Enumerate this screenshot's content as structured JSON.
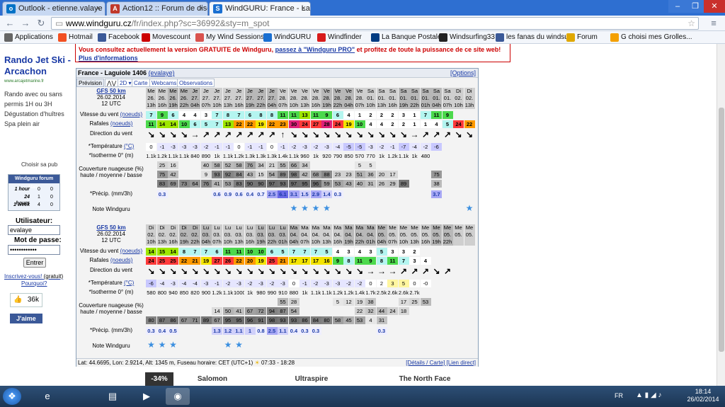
{
  "browser": {
    "tabs": [
      {
        "label": "Outlook - etienne.valaye",
        "icon": "outlook-icon",
        "icon_text": "o"
      },
      {
        "label": "Action12 :: Forum de disc",
        "icon": "forum-icon",
        "icon_text": "A"
      },
      {
        "label": "WindGURU: France - Lagu",
        "icon": "windguru-icon",
        "icon_text": "S"
      }
    ],
    "tab_close": "×",
    "url_domain": "www.windguru.cz",
    "url_path": "/fr/index.php?sc=36992&sty=m_spot",
    "bookmarks": [
      {
        "label": "Applications",
        "icon": "apps-icon",
        "color": "#666"
      },
      {
        "label": "Hotmail",
        "icon": "hotmail-icon",
        "color": "#f25022"
      },
      {
        "label": "Facebook",
        "icon": "facebook-icon",
        "color": "#3b5998"
      },
      {
        "label": "Movescount",
        "icon": "movescount-icon",
        "color": "#c00"
      },
      {
        "label": "My Wind Sessions",
        "icon": "windsessions-icon",
        "color": "#d9534f"
      },
      {
        "label": "WindGURU",
        "icon": "windguru-bm-icon",
        "color": "#1a6fd1"
      },
      {
        "label": "Windfinder",
        "icon": "windfinder-icon",
        "color": "#d81b1b"
      },
      {
        "label": "La Banque Postale",
        "icon": "banque-icon",
        "color": "#003c82"
      },
      {
        "label": "Windsurfing33",
        "icon": "windsurfing-icon",
        "color": "#222"
      },
      {
        "label": "les fanas du windsurf",
        "icon": "fanas-icon",
        "color": "#3b5998"
      },
      {
        "label": "Forum",
        "icon": "folder-icon",
        "color": "#e0a800"
      },
      {
        "label": "G choisi mes Grolles...",
        "icon": "grolles-icon",
        "color": "#f4a000"
      }
    ]
  },
  "sidebar": {
    "ad_title": "Rando Jet Ski - Arcachon",
    "ad_url": "www.arcajetmarine.fr",
    "ad_text": "Rando avec ou sans permis 1H ou 3H Dégustation d'huîtres Spa plein air",
    "ad_choice": "Choisir sa pub",
    "forum_stats_title": "Windguru forum stats",
    "stats": [
      {
        "k": "1 hour",
        "a": "0",
        "b": "0"
      },
      {
        "k": "24 hours",
        "a": "1",
        "b": "0"
      },
      {
        "k": "1 week",
        "a": "4",
        "b": "0"
      }
    ],
    "user_label": "Utilisateur:",
    "user_value": "evalaye",
    "pass_label": "Mot de passe:",
    "pass_value": "••••••••••••",
    "enter": "Entrer",
    "register": "Inscrivez-vous!",
    "register_note": "(gratuit)",
    "why": "Pourquoi?",
    "likes": "36k",
    "like_btn": "J'aime"
  },
  "notice": {
    "text1": "Vous consultez actuellement la version GRATUITE de Windguru,",
    "link1": "passez à \"Windguru PRO\"",
    "text2": "et profitez de toute la puissance de ce site web!",
    "link2": "Plus d'informations"
  },
  "panel": {
    "title": "France - Laguiole 1406",
    "user": "(evalaye)",
    "options": "[Options]",
    "tabs": [
      "Prévision",
      "2D ▾",
      "Carte",
      "Webcams",
      "Observations"
    ],
    "footer": "Lat: 44.6695, Lon: 2.9214, Alt: 1345 m, Fuseau horaire: CET (UTC+1)",
    "sun": "07:33 - 18:28",
    "footer_links": "[Détails / Carte] [Lien direct]"
  },
  "labels": {
    "model": "GFS 50 km",
    "date": "26.02.2014",
    "utc": "12 UTC",
    "wind": "Vitesse du vent",
    "wind_unit": "(noeuds)",
    "gust": "Rafales",
    "dir": "Direction du vent",
    "temp": "*Température",
    "temp_unit": "(°C)",
    "iso": "*Isotherme 0° (m)",
    "cloud": "Couverture nuageuse (%) haute / moyenne / basse",
    "precip": "*Précip. (mm/3h)",
    "rating": "Note Windguru"
  },
  "block1": {
    "day": [
      "Me",
      "Me",
      "Me",
      "Me",
      "Je",
      "Je",
      "Je",
      "Je",
      "Je",
      "Je",
      "Je",
      "Je",
      "Ve",
      "Ve",
      "Ve",
      "Ve",
      "Ve",
      "Ve",
      "Ve",
      "Ve",
      "Sa",
      "Sa",
      "Sa",
      "Sa",
      "Sa",
      "Sa",
      "Sa",
      "Sa",
      "Di",
      "Di"
    ],
    "dnum": [
      "26.",
      "26.",
      "26.",
      "26.",
      "27.",
      "27.",
      "27.",
      "27.",
      "27.",
      "27.",
      "27.",
      "27.",
      "28.",
      "28.",
      "28.",
      "28.",
      "28.",
      "28.",
      "28.",
      "28.",
      "01.",
      "01.",
      "01.",
      "01.",
      "01.",
      "01.",
      "01.",
      "01.",
      "02.",
      "02."
    ],
    "hour": [
      "13h",
      "16h",
      "19h",
      "22h",
      "04h",
      "07h",
      "10h",
      "13h",
      "16h",
      "19h",
      "22h",
      "04h",
      "07h",
      "10h",
      "13h",
      "16h",
      "19h",
      "22h",
      "04h",
      "07h",
      "10h",
      "13h",
      "16h",
      "19h",
      "22h",
      "01h",
      "04h",
      "07h",
      "10h",
      "13h"
    ],
    "wind": [
      "7",
      "9",
      "6",
      "4",
      "4",
      "3",
      "7",
      "8",
      "7",
      "6",
      "8",
      "8",
      "11",
      "11",
      "13",
      "11",
      "9",
      "6",
      "4",
      "1",
      "2",
      "2",
      "2",
      "3",
      "1",
      "7",
      "11",
      "9",
      "",
      ""
    ],
    "gust": [
      "11",
      "14",
      "14",
      "10",
      "6",
      "5",
      "7",
      "13",
      "22",
      "22",
      "19",
      "22",
      "23",
      "30",
      "24",
      "27",
      "28",
      "24",
      "19",
      "10",
      "4",
      "4",
      "2",
      "2",
      "1",
      "1",
      "4",
      "5",
      "24",
      "22"
    ],
    "dir": [
      "↘",
      "↘",
      "↘",
      "↘",
      "→",
      "↗",
      "↗",
      "↗",
      "↗",
      "↗",
      "↗",
      "↗",
      "↑",
      "↘",
      "↘",
      "↘",
      "↘",
      "↘",
      "↘",
      "↘",
      "↘",
      "↘",
      "↘",
      "↘",
      "→",
      "↗",
      "↗",
      "↗",
      "↘",
      "↘"
    ],
    "temp": [
      "0",
      "-1",
      "-3",
      "-3",
      "-3",
      "-2",
      "-1",
      "-1",
      "0",
      "-1",
      "-1",
      "0",
      "-1",
      "-2",
      "-3",
      "-2",
      "-3",
      "-4",
      "-5",
      "-5",
      "-3",
      "-2",
      "-1",
      "-7",
      "-4",
      "-2",
      "-6",
      "",
      "",
      ""
    ],
    "iso": [
      "1.1k",
      "1.2k",
      "1.1k",
      "1.1k",
      "840",
      "890",
      "1k",
      "1.1k",
      "1.2k",
      "1.3k",
      "1.3k",
      "1.3k",
      "1.4k",
      "1.1k",
      "960",
      "1k",
      "920",
      "790",
      "850",
      "570",
      "770",
      "1k",
      "1.2k",
      "1.1k",
      "1k",
      "480",
      "",
      "",
      "",
      ""
    ],
    "cloud_h": [
      "",
      "25",
      "16",
      "",
      "",
      "40",
      "58",
      "52",
      "58",
      "76",
      "34",
      "21",
      "55",
      "66",
      "34",
      "",
      "",
      "",
      "",
      "5",
      "5",
      "",
      "",
      "",
      "",
      "",
      "",
      "",
      "",
      ""
    ],
    "cloud_m": [
      "",
      "75",
      "42",
      "",
      "",
      "9",
      "93",
      "92",
      "84",
      "43",
      "15",
      "54",
      "89",
      "98",
      "42",
      "68",
      "88",
      "23",
      "23",
      "51",
      "36",
      "20",
      "17",
      "",
      "",
      "",
      "75",
      "",
      "",
      ""
    ],
    "cloud_l": [
      "",
      "83",
      "69",
      "73",
      "64",
      "76",
      "41",
      "53",
      "83",
      "90",
      "90",
      "97",
      "93",
      "97",
      "95",
      "96",
      "59",
      "53",
      "43",
      "40",
      "31",
      "26",
      "29",
      "89",
      "",
      "",
      "38",
      "",
      "",
      ""
    ],
    "precip": [
      "",
      "0.3",
      "",
      "",
      "",
      "",
      "0.6",
      "0.9",
      "0.6",
      "0.4",
      "0.7",
      "2.5",
      "6.1",
      "3.1",
      "1.5",
      "2.9",
      "1.4",
      "0.3",
      "",
      "",
      "",
      "",
      "",
      "",
      "",
      "",
      "3.7",
      "",
      "",
      ""
    ],
    "stars": [
      0,
      0,
      0,
      0,
      0,
      0,
      0,
      0,
      0,
      0,
      0,
      0,
      0,
      1,
      1,
      1,
      1,
      0,
      0,
      0,
      0,
      0,
      0,
      0,
      0,
      0,
      0,
      0,
      0,
      1
    ]
  },
  "block2": {
    "day": [
      "Di",
      "Di",
      "Di",
      "Di",
      "Di",
      "Lu",
      "Lu",
      "Lu",
      "Lu",
      "Lu",
      "Lu",
      "Lu",
      "Lu",
      "Ma",
      "Ma",
      "Ma",
      "Ma",
      "Ma",
      "Ma",
      "Ma",
      "Ma",
      "Me",
      "Me",
      "Me",
      "Me",
      "Me",
      "Me",
      "Me",
      "Me",
      "Me"
    ],
    "dnum": [
      "02.",
      "02.",
      "02.",
      "02.",
      "02.",
      "03.",
      "03.",
      "03.",
      "03.",
      "03.",
      "03.",
      "03.",
      "03.",
      "04.",
      "04.",
      "04.",
      "04.",
      "04.",
      "04.",
      "04.",
      "04.",
      "05.",
      "05.",
      "05.",
      "05.",
      "05.",
      "05.",
      "05.",
      "05.",
      "05."
    ],
    "hour": [
      "10h",
      "13h",
      "16h",
      "19h",
      "22h",
      "04h",
      "07h",
      "10h",
      "13h",
      "16h",
      "19h",
      "22h",
      "01h",
      "04h",
      "07h",
      "10h",
      "13h",
      "16h",
      "19h",
      "22h",
      "01h",
      "04h",
      "07h",
      "10h",
      "13h",
      "16h",
      "19h",
      "22h",
      "",
      ""
    ],
    "wind": [
      "14",
      "15",
      "14",
      "8",
      "7",
      "7",
      "6",
      "11",
      "11",
      "10",
      "10",
      "6",
      "5",
      "7",
      "7",
      "7",
      "5",
      "4",
      "3",
      "4",
      "3",
      "5",
      "3",
      "3",
      "2",
      "",
      "",
      "",
      "",
      ""
    ],
    "gust": [
      "24",
      "25",
      "25",
      "22",
      "21",
      "19",
      "27",
      "26",
      "22",
      "20",
      "19",
      "25",
      "21",
      "17",
      "17",
      "17",
      "16",
      "9",
      "8",
      "11",
      "9",
      "8",
      "11",
      "7",
      "3",
      "4",
      "",
      "",
      "",
      ""
    ],
    "dir": [
      "↘",
      "↘",
      "↘",
      "↘",
      "↘",
      "↘",
      "↘",
      "↘",
      "↘",
      "↘",
      "↘",
      "↘",
      "↘",
      "↘",
      "↘",
      "↘",
      "↘",
      "↘",
      "↘",
      "↘",
      "→",
      "→",
      "→",
      "↗",
      "↗",
      "↗",
      "↘",
      "↗",
      "",
      ""
    ],
    "temp": [
      "-6",
      "-4",
      "-3",
      "-4",
      "-4",
      "-3",
      "-1",
      "-2",
      "-3",
      "-2",
      "-3",
      "-2",
      "-3",
      "0",
      "-1",
      "-2",
      "-3",
      "-3",
      "-2",
      "-2",
      "0",
      "2",
      "3",
      "5",
      "0",
      "-0",
      "",
      "",
      "",
      ""
    ],
    "iso": [
      "580",
      "800",
      "940",
      "850",
      "820",
      "900",
      "1.2k",
      "1.1k",
      "1000",
      "1k",
      "980",
      "990",
      "910",
      "880",
      "1k",
      "1.1k",
      "1.1k",
      "1.2k",
      "1.2k",
      "1.4k",
      "1.7k",
      "2.5k",
      "2.6k",
      "2.6k",
      "2.7k",
      "",
      "",
      "",
      "",
      ""
    ],
    "cloud_h": [
      "",
      "",
      "",
      "",
      "",
      "",
      "",
      "",
      "",
      "",
      "",
      "",
      "55",
      "28",
      "",
      "",
      "",
      "5",
      "12",
      "19",
      "38",
      "",
      "",
      "17",
      "25",
      "53",
      "",
      "",
      "",
      ""
    ],
    "cloud_m": [
      "",
      "",
      "",
      "",
      "",
      "",
      "14",
      "50",
      "41",
      "67",
      "72",
      "94",
      "87",
      "54",
      "",
      "",
      "",
      "",
      "",
      "22",
      "32",
      "44",
      "24",
      "18",
      "",
      "",
      "",
      "",
      "",
      ""
    ],
    "cloud_l": [
      "80",
      "87",
      "86",
      "67",
      "71",
      "89",
      "67",
      "95",
      "95",
      "96",
      "91",
      "98",
      "93",
      "93",
      "86",
      "84",
      "80",
      "58",
      "45",
      "53",
      "4",
      "31",
      "",
      "",
      "",
      "",
      "",
      "",
      "",
      ""
    ],
    "precip": [
      "0.3",
      "0.4",
      "0.5",
      "",
      "",
      "",
      "1.3",
      "1.2",
      "1.1",
      "1",
      "0.8",
      "2.5",
      "1.1",
      "0.4",
      "0.3",
      "0.3",
      "",
      "",
      "",
      "",
      "",
      "0.3",
      "",
      "",
      "",
      "",
      "",
      "",
      "",
      ""
    ],
    "stars": [
      1,
      1,
      1,
      0,
      0,
      0,
      0,
      1,
      1,
      0,
      0,
      0,
      0,
      0,
      0,
      0,
      0,
      0,
      0,
      0,
      0,
      0,
      0,
      0,
      0,
      0,
      0,
      0,
      0,
      0
    ]
  },
  "ads": [
    {
      "label": "-34%",
      "bg": "#333",
      "fg": "#fff"
    },
    {
      "label": "Salomon",
      "bg": "#fff",
      "fg": "#333"
    },
    {
      "label": "Ultraspire",
      "bg": "#fff",
      "fg": "#333"
    },
    {
      "label": "The North Face",
      "bg": "#fff",
      "fg": "#333"
    }
  ],
  "taskbar": {
    "lang": "FR",
    "time": "18:14",
    "date": "26/02/2014",
    "apps": [
      "windows-start-icon",
      "ie-icon",
      "explorer-icon",
      "media-icon",
      "chrome-icon"
    ]
  }
}
